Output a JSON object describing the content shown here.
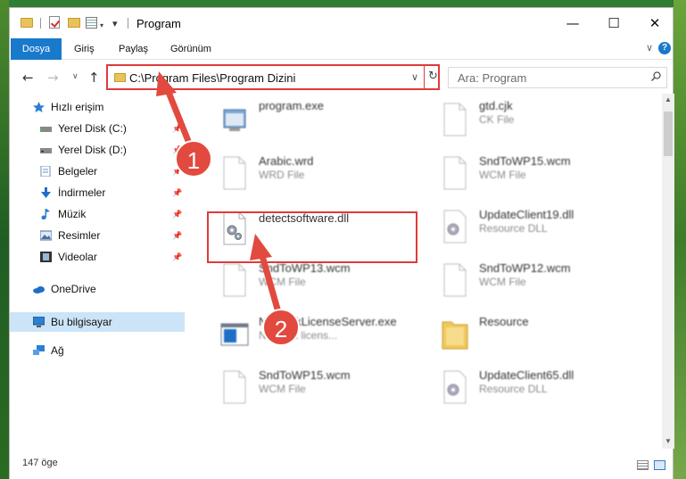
{
  "window": {
    "title": "Program",
    "controls": {
      "minimize": "—",
      "maximize": "☐",
      "close": "✕"
    }
  },
  "ribbon": {
    "tabs": [
      "Dosya",
      "Giriş",
      "Paylaş",
      "Görünüm"
    ],
    "help": "?"
  },
  "address": {
    "path": "C:\\Program Files\\Program Dizini",
    "search_placeholder": "Ara: Program"
  },
  "sidebar": {
    "items": [
      {
        "label": "Hızlı erişim",
        "icon": "star-icon"
      },
      {
        "label": "Yerel Disk (C:)",
        "icon": "drive-icon",
        "pinned": true
      },
      {
        "label": "Yerel Disk (D:)",
        "icon": "drive-icon",
        "pinned": true
      },
      {
        "label": "Belgeler",
        "icon": "documents-icon",
        "pinned": true
      },
      {
        "label": "İndirmeler",
        "icon": "download-icon",
        "pinned": true
      },
      {
        "label": "Müzik",
        "icon": "music-icon",
        "pinned": true
      },
      {
        "label": "Resimler",
        "icon": "pictures-icon",
        "pinned": true
      },
      {
        "label": "Videolar",
        "icon": "video-icon",
        "pinned": true
      },
      {
        "label": "OneDrive",
        "icon": "cloud-icon"
      },
      {
        "label": "Bu bilgisayar",
        "icon": "computer-icon",
        "selected": true
      },
      {
        "label": "Ağ",
        "icon": "network-icon"
      }
    ]
  },
  "files": [
    {
      "name": "program.exe",
      "type": "",
      "icon": "exe-icon"
    },
    {
      "name": "gtd.cjk",
      "type": "CK File",
      "icon": "blank-file-icon"
    },
    {
      "name": "Arabic.wrd",
      "type": "WRD File",
      "icon": "blank-file-icon"
    },
    {
      "name": "SndToWP15.wcm",
      "type": "WCM File",
      "icon": "blank-file-icon"
    },
    {
      "name": "detectsoftware.dll",
      "type": "",
      "icon": "dll-gear-icon",
      "highlighted": true
    },
    {
      "name": "UpdateClient19.dll",
      "type": "Resource DLL",
      "icon": "dll-gear-icon"
    },
    {
      "name": "SndToWP13.wcm",
      "type": "WCM File",
      "icon": "blank-file-icon"
    },
    {
      "name": "SndToWP12.wcm",
      "type": "WCM File",
      "icon": "blank-file-icon"
    },
    {
      "name": "NetworkLicenseServer.exe",
      "type": "Network licens...",
      "icon": "app-window-icon"
    },
    {
      "name": "Resource",
      "type": "",
      "icon": "folder-icon"
    },
    {
      "name": "SndToWP15.wcm",
      "type": "WCM File",
      "icon": "blank-file-icon"
    },
    {
      "name": "UpdateClient65.dll",
      "type": "Resource DLL",
      "icon": "dll-gear-icon"
    }
  ],
  "status": {
    "count": "147 öge"
  },
  "annotations": [
    {
      "number": "1"
    },
    {
      "number": "2"
    }
  ],
  "colors": {
    "accent": "#1979ca",
    "highlight": "#e03a3a",
    "selection": "#cce4f7",
    "badge": "#e24a3f"
  }
}
